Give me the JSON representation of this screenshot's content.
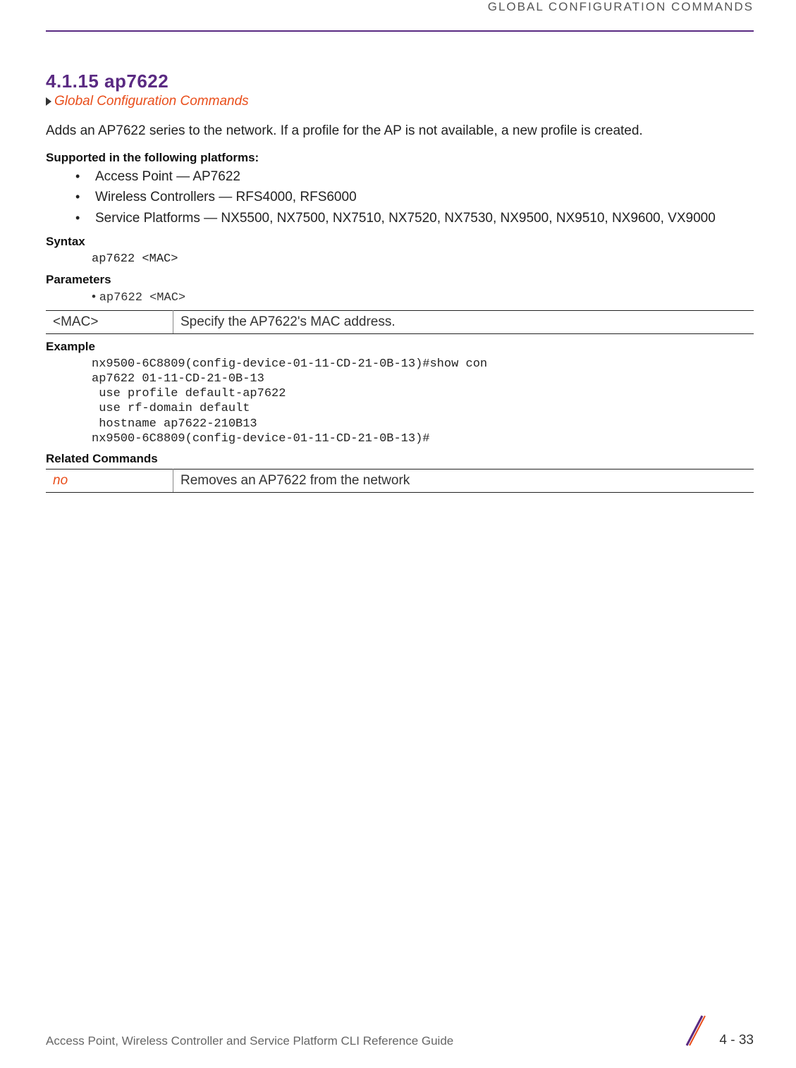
{
  "header": {
    "running_title": "GLOBAL CONFIGURATION COMMANDS"
  },
  "section": {
    "number_title": "4.1.15 ap7622",
    "breadcrumb": "Global Configuration Commands",
    "intro": "Adds an AP7622 series to the network. If a profile for the AP is not available, a new profile is created."
  },
  "supported": {
    "heading": "Supported in the following platforms:",
    "items": [
      "Access Point — AP7622",
      "Wireless Controllers — RFS4000, RFS6000",
      "Service Platforms — NX5500, NX7500, NX7510, NX7520, NX7530, NX9500, NX9510, NX9600, VX9000"
    ]
  },
  "syntax": {
    "heading": "Syntax",
    "code": "ap7622 <MAC>"
  },
  "parameters": {
    "heading": "Parameters",
    "bullet": "ap7622 <MAC>",
    "table": [
      {
        "name": "<MAC>",
        "desc": "Specify the AP7622's MAC address."
      }
    ]
  },
  "example": {
    "heading": "Example",
    "code": "nx9500-6C8809(config-device-01-11-CD-21-0B-13)#show con\nap7622 01-11-CD-21-0B-13\n use profile default-ap7622\n use rf-domain default\n hostname ap7622-210B13\nnx9500-6C8809(config-device-01-11-CD-21-0B-13)#"
  },
  "related": {
    "heading": "Related Commands",
    "table": [
      {
        "name": "no",
        "desc": "Removes an AP7622 from the network"
      }
    ]
  },
  "footer": {
    "guide": "Access Point, Wireless Controller and Service Platform CLI Reference Guide",
    "page": "4 - 33"
  }
}
